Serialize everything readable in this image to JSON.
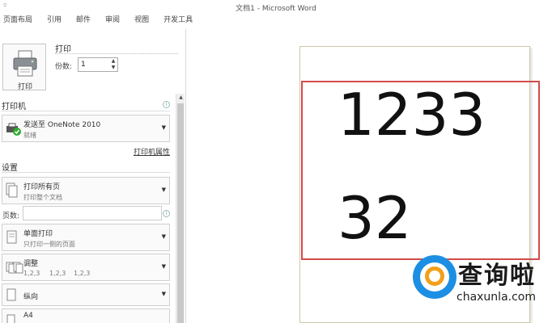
{
  "window": {
    "title": "文档1 - Microsoft Word",
    "qat_icon": "customize-arrow-icon"
  },
  "ribbon": {
    "tabs": [
      "页面布局",
      "引用",
      "邮件",
      "审阅",
      "视图",
      "开发工具"
    ]
  },
  "print_panel": {
    "heading": "打印",
    "print_button_label": "打印",
    "copies_label": "份数:",
    "copies_value": "1"
  },
  "printer": {
    "section_title": "打印机",
    "name": "发送至 OneNote 2010",
    "status": "就绪",
    "properties_link": "打印机属性"
  },
  "settings": {
    "section_title": "设置",
    "range_main": "打印所有页",
    "range_sub": "打印整个文档",
    "pages_label": "页数:",
    "sides_main": "单面打印",
    "sides_sub": "只打印一侧的页面",
    "collate_main": "调整",
    "collate_items": [
      "1,2,3",
      "1,2,3",
      "1,2,3"
    ],
    "orientation": "纵向",
    "paper": "A4"
  },
  "preview": {
    "doc_lines": [
      "1233",
      "32"
    ]
  },
  "watermark": {
    "brand_cn": "查询啦",
    "brand_en": "chaxunla.com"
  },
  "colors": {
    "highlight_border": "#d44a4a",
    "watermark_blue": "#1c8fe3",
    "watermark_orange": "#f2a01b"
  }
}
